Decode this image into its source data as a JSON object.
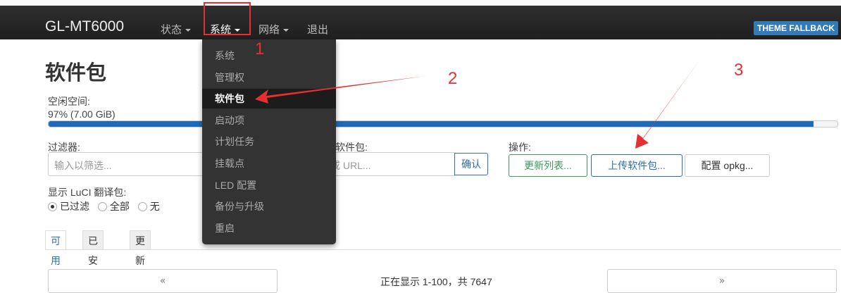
{
  "header": {
    "brand": "GL-MT6000",
    "nav": [
      {
        "label": "状态"
      },
      {
        "label": "系统"
      },
      {
        "label": "网络"
      },
      {
        "label": "退出"
      }
    ],
    "theme_badge": "THEME FALLBACK"
  },
  "dropdown": {
    "items": [
      {
        "label": "系统",
        "active": false
      },
      {
        "label": "管理权",
        "active": false
      },
      {
        "label": "软件包",
        "active": true
      },
      {
        "label": "启动项",
        "active": false
      },
      {
        "label": "计划任务",
        "active": false
      },
      {
        "label": "挂载点",
        "active": false
      },
      {
        "label": "LED 配置",
        "active": false
      },
      {
        "label": "备份与升级",
        "active": false
      },
      {
        "label": "重启",
        "active": false
      }
    ]
  },
  "page": {
    "title": "软件包",
    "free_space_label": "空闲空间:",
    "free_space_value": "97% (7.00 GiB)",
    "free_space_fraction": 0.97,
    "filter_label": "过滤器:",
    "filter_placeholder": "输入以筛选...",
    "download_label_partial": "软件包:",
    "download_placeholder_partial": "或 URL...",
    "confirm_button": "确认",
    "actions_label": "操作:",
    "update_lists_button": "更新列表...",
    "upload_package_button": "上传软件包...",
    "configure_opkg_button": "配置 opkg...",
    "show_translations_label": "显示 LuCI 翻译包:",
    "radio_options": [
      {
        "label": "已过滤",
        "checked": true
      },
      {
        "label": "全部",
        "checked": false
      },
      {
        "label": "无",
        "checked": false
      }
    ],
    "tabs": [
      {
        "label": "可用",
        "active": true
      },
      {
        "label": "已安装",
        "active": false
      },
      {
        "label": "更新",
        "active": false
      }
    ],
    "pager": {
      "prev": "«",
      "status": "正在显示 1-100，共 7647",
      "next": "»"
    }
  },
  "annotations": {
    "numbers": [
      "1",
      "2",
      "3"
    ],
    "color": "#e53030"
  }
}
